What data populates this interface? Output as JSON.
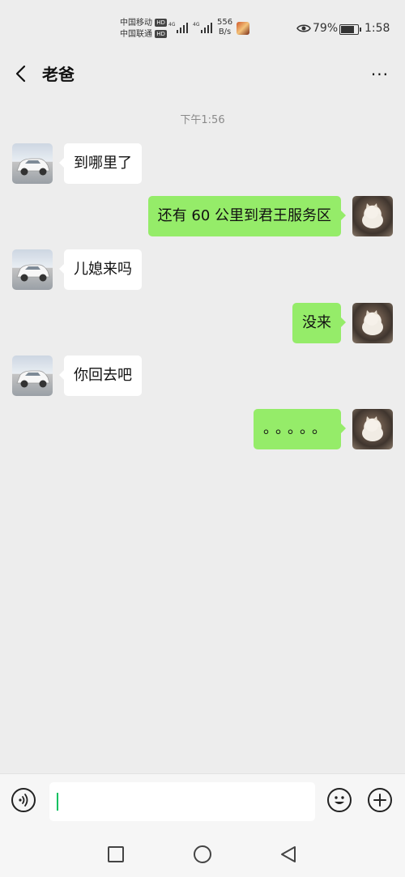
{
  "status_bar": {
    "carrier_1": "中国移动",
    "carrier_2": "中国联通",
    "hd": "HD",
    "network": "4G",
    "speed_value": "556",
    "speed_unit": "B/s",
    "battery": "79%",
    "battery_level": 0.79,
    "time": "1:58"
  },
  "header": {
    "title": "老爸",
    "more": "···"
  },
  "timestamp": "下午1:56",
  "messages": [
    {
      "side": "in",
      "text": "到哪里了"
    },
    {
      "side": "out",
      "text": "还有 60 公里到君王服务区"
    },
    {
      "side": "in",
      "text": "儿媳来吗"
    },
    {
      "side": "out",
      "text": "没来"
    },
    {
      "side": "in",
      "text": "你回去吧"
    },
    {
      "side": "out",
      "text": "。。。。。"
    }
  ],
  "input_bar": {
    "value": ""
  },
  "icons": {
    "back": "chevron-left-icon",
    "voice": "voice-icon",
    "emoji": "emoji-icon",
    "plus": "plus-icon",
    "nav_recents": "square-icon",
    "nav_home": "circle-icon",
    "nav_back": "triangle-back-icon"
  }
}
